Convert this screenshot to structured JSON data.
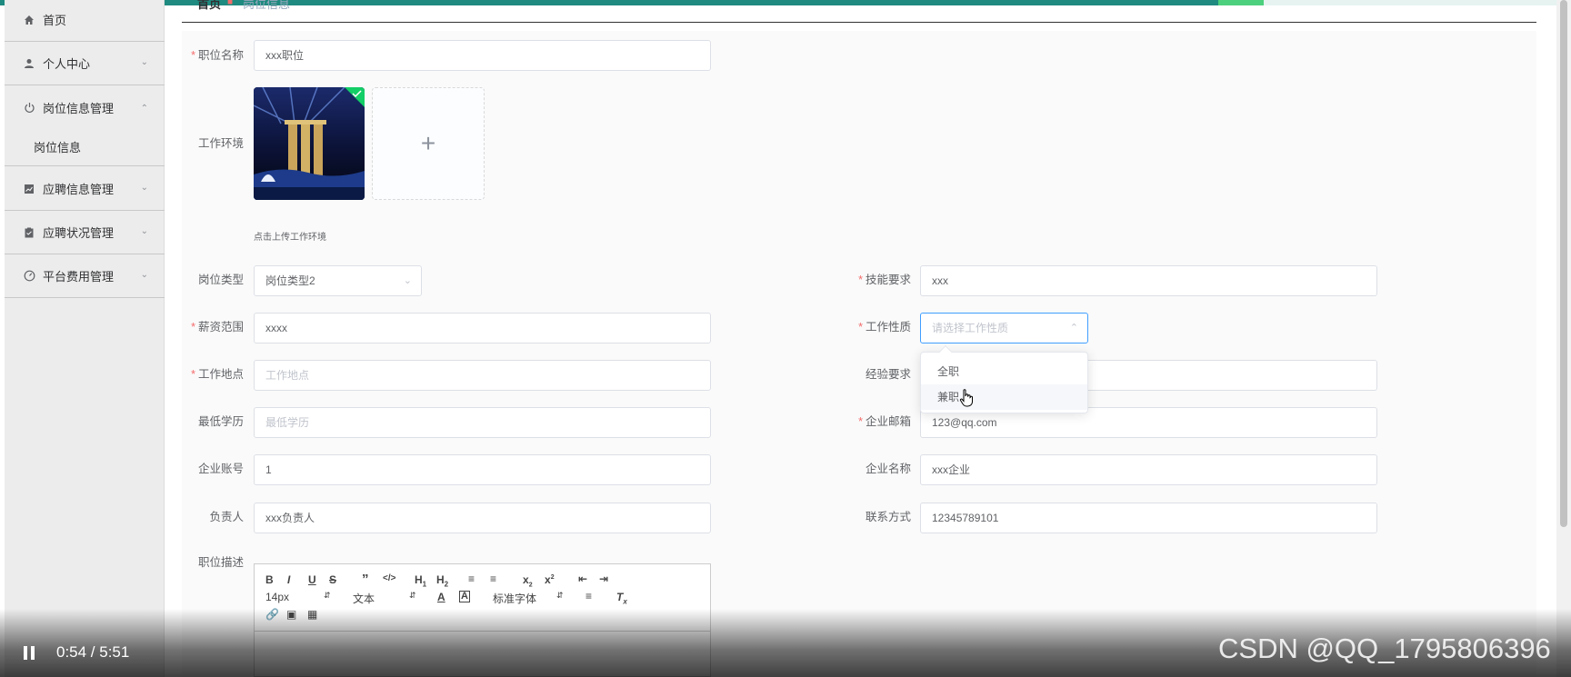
{
  "colors": {
    "accent": "#1f8a7f",
    "required": "#f56c6c"
  },
  "sidebar": {
    "items": [
      {
        "label": "首页",
        "icon": "home-icon"
      },
      {
        "label": "个人中心",
        "icon": "user-icon"
      },
      {
        "label": "岗位信息管理",
        "icon": "power-icon"
      },
      {
        "label": "应聘信息管理",
        "icon": "chart-icon"
      },
      {
        "label": "应聘状况管理",
        "icon": "clipboard-icon"
      },
      {
        "label": "平台费用管理",
        "icon": "gauge-icon"
      }
    ],
    "sub_item": "岗位信息"
  },
  "breadcrumb": {
    "home": "首页",
    "current": "岗位信息"
  },
  "form": {
    "job_name": {
      "label": "职位名称",
      "value": "xxx职位"
    },
    "work_env": {
      "label": "工作环境",
      "hint": "点击上传工作环境"
    },
    "job_type": {
      "label": "岗位类型",
      "value": "岗位类型2"
    },
    "skills": {
      "label": "技能要求",
      "value": "xxx"
    },
    "salary": {
      "label": "薪资范围",
      "value": "xxxx"
    },
    "work_nature": {
      "label": "工作性质",
      "placeholder": "请选择工作性质"
    },
    "location": {
      "label": "工作地点",
      "placeholder": "工作地点"
    },
    "experience": {
      "label": "经验要求"
    },
    "education": {
      "label": "最低学历",
      "placeholder": "最低学历"
    },
    "email": {
      "label": "企业邮箱",
      "value": "123@qq.com"
    },
    "account": {
      "label": "企业账号",
      "value": "1"
    },
    "company": {
      "label": "企业名称",
      "value": "xxx企业"
    },
    "manager": {
      "label": "负责人",
      "value": "xxx负责人"
    },
    "contact": {
      "label": "联系方式",
      "value": "12345789101"
    },
    "description": {
      "label": "职位描述"
    }
  },
  "dropdown": {
    "options": [
      "全职",
      "兼职"
    ]
  },
  "editor": {
    "font_size": "14px",
    "text_type": "文本",
    "font_family": "标准字体"
  },
  "video": {
    "time": "0:54 / 5:51",
    "watermark": "CSDN @QQ_1795806396"
  }
}
